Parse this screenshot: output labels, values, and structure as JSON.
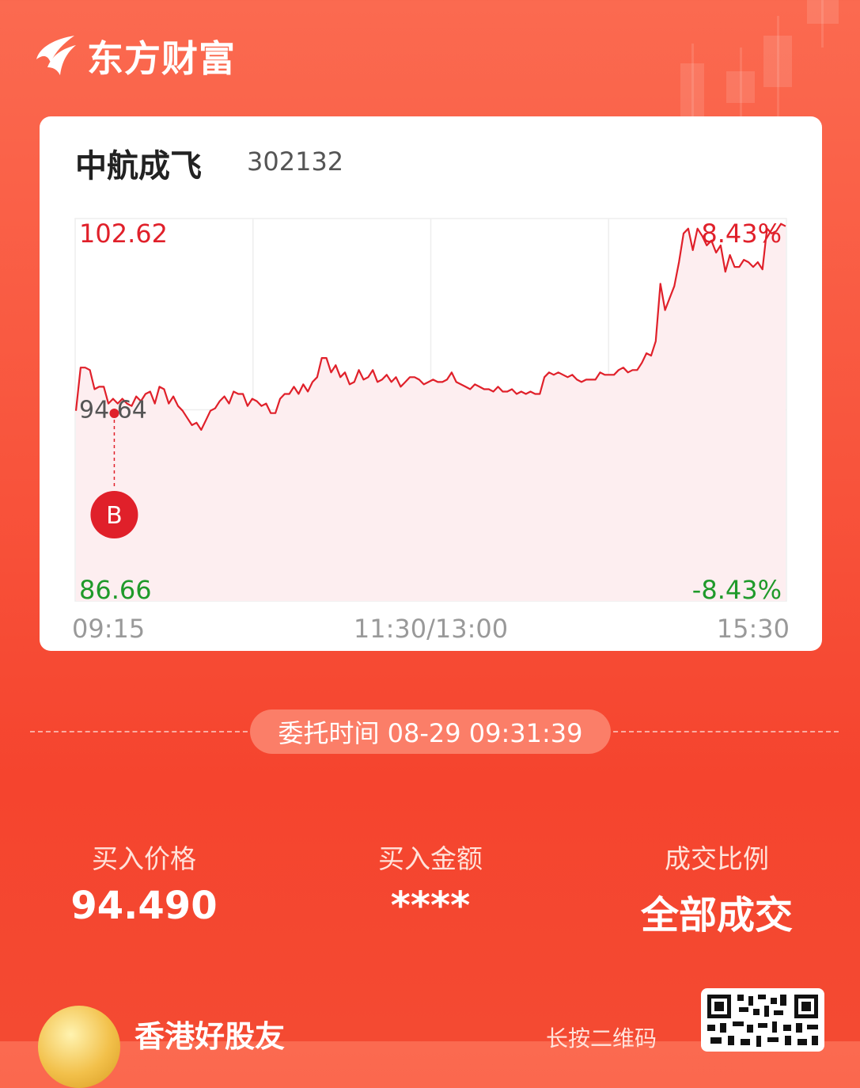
{
  "brand": {
    "name": "东方财富"
  },
  "stock": {
    "name": "中航成飞",
    "code": "302132"
  },
  "chart_data": {
    "type": "line",
    "x_ticks": [
      "09:15",
      "11:30/13:00",
      "15:30"
    ],
    "y_top_label": "102.62",
    "y_bottom_label": "86.66",
    "y_mid_label": "94.64",
    "pct_top_label": "8.43%",
    "pct_bottom_label": "-8.43%",
    "ylim": [
      86.66,
      102.62
    ],
    "prev_close": 94.64,
    "grid": true,
    "series": [
      {
        "values": [
          94.6,
          96.4,
          96.4,
          96.3,
          95.5,
          95.6,
          95.6,
          94.9,
          95.1,
          94.9,
          95.1,
          94.9,
          94.8,
          95.2,
          95.0,
          95.3,
          95.4,
          94.9,
          95.6,
          95.5,
          94.9,
          95.2,
          94.8,
          94.6,
          94.3,
          94.0,
          94.1,
          93.8,
          94.2,
          94.6,
          94.7,
          95.0,
          95.2,
          94.9,
          95.4,
          95.3,
          95.3,
          94.8,
          95.1,
          95.0,
          94.8,
          94.9,
          94.5,
          94.5,
          95.1,
          95.3,
          95.3,
          95.6,
          95.3,
          95.7,
          95.4,
          95.8,
          96.0,
          96.8,
          96.8,
          96.2,
          96.5,
          96.0,
          96.2,
          95.7,
          95.8,
          96.3,
          95.9,
          96.0,
          96.3,
          95.8,
          95.9,
          96.1,
          95.8,
          96.0,
          95.6,
          95.8,
          96.0,
          96.0,
          95.9,
          95.7,
          95.8,
          95.9,
          95.8,
          95.8,
          95.9,
          96.2,
          95.8,
          95.7,
          95.6,
          95.5,
          95.7,
          95.6,
          95.5,
          95.5,
          95.4,
          95.6,
          95.4,
          95.4,
          95.5,
          95.3,
          95.4,
          95.3,
          95.4,
          95.3,
          95.3,
          96.0,
          96.2,
          96.1,
          96.2,
          96.1,
          96.0,
          96.1,
          95.9,
          95.8,
          95.9,
          95.9,
          95.9,
          96.2,
          96.1,
          96.1,
          96.1,
          96.3,
          96.4,
          96.2,
          96.3,
          96.3,
          96.6,
          97.0,
          96.9,
          97.5,
          99.9,
          98.8,
          99.3,
          99.8,
          100.8,
          102.0,
          102.2,
          101.3,
          102.2,
          101.9,
          101.5,
          101.7,
          101.2,
          101.5,
          100.4,
          101.1,
          100.6,
          100.6,
          100.9,
          100.8,
          100.6,
          100.8,
          100.5,
          102.2,
          102.0,
          102.1,
          102.4,
          102.3
        ]
      }
    ]
  },
  "buy_marker": {
    "label": "B",
    "price": 94.49
  },
  "order_time": "委托时间 08-29 09:31:39",
  "stats": {
    "price_label": "买入价格",
    "price_value": "94.490",
    "amount_label": "买入金额",
    "amount_value": "****",
    "ratio_label": "成交比例",
    "ratio_value": "全部成交"
  },
  "footer": {
    "name": "香港好股友",
    "hint": "长按二维码"
  },
  "colors": {
    "red": "#e0202a",
    "green": "#1f9a2a",
    "line": "#e0202a",
    "fill": "#fdeef0"
  }
}
